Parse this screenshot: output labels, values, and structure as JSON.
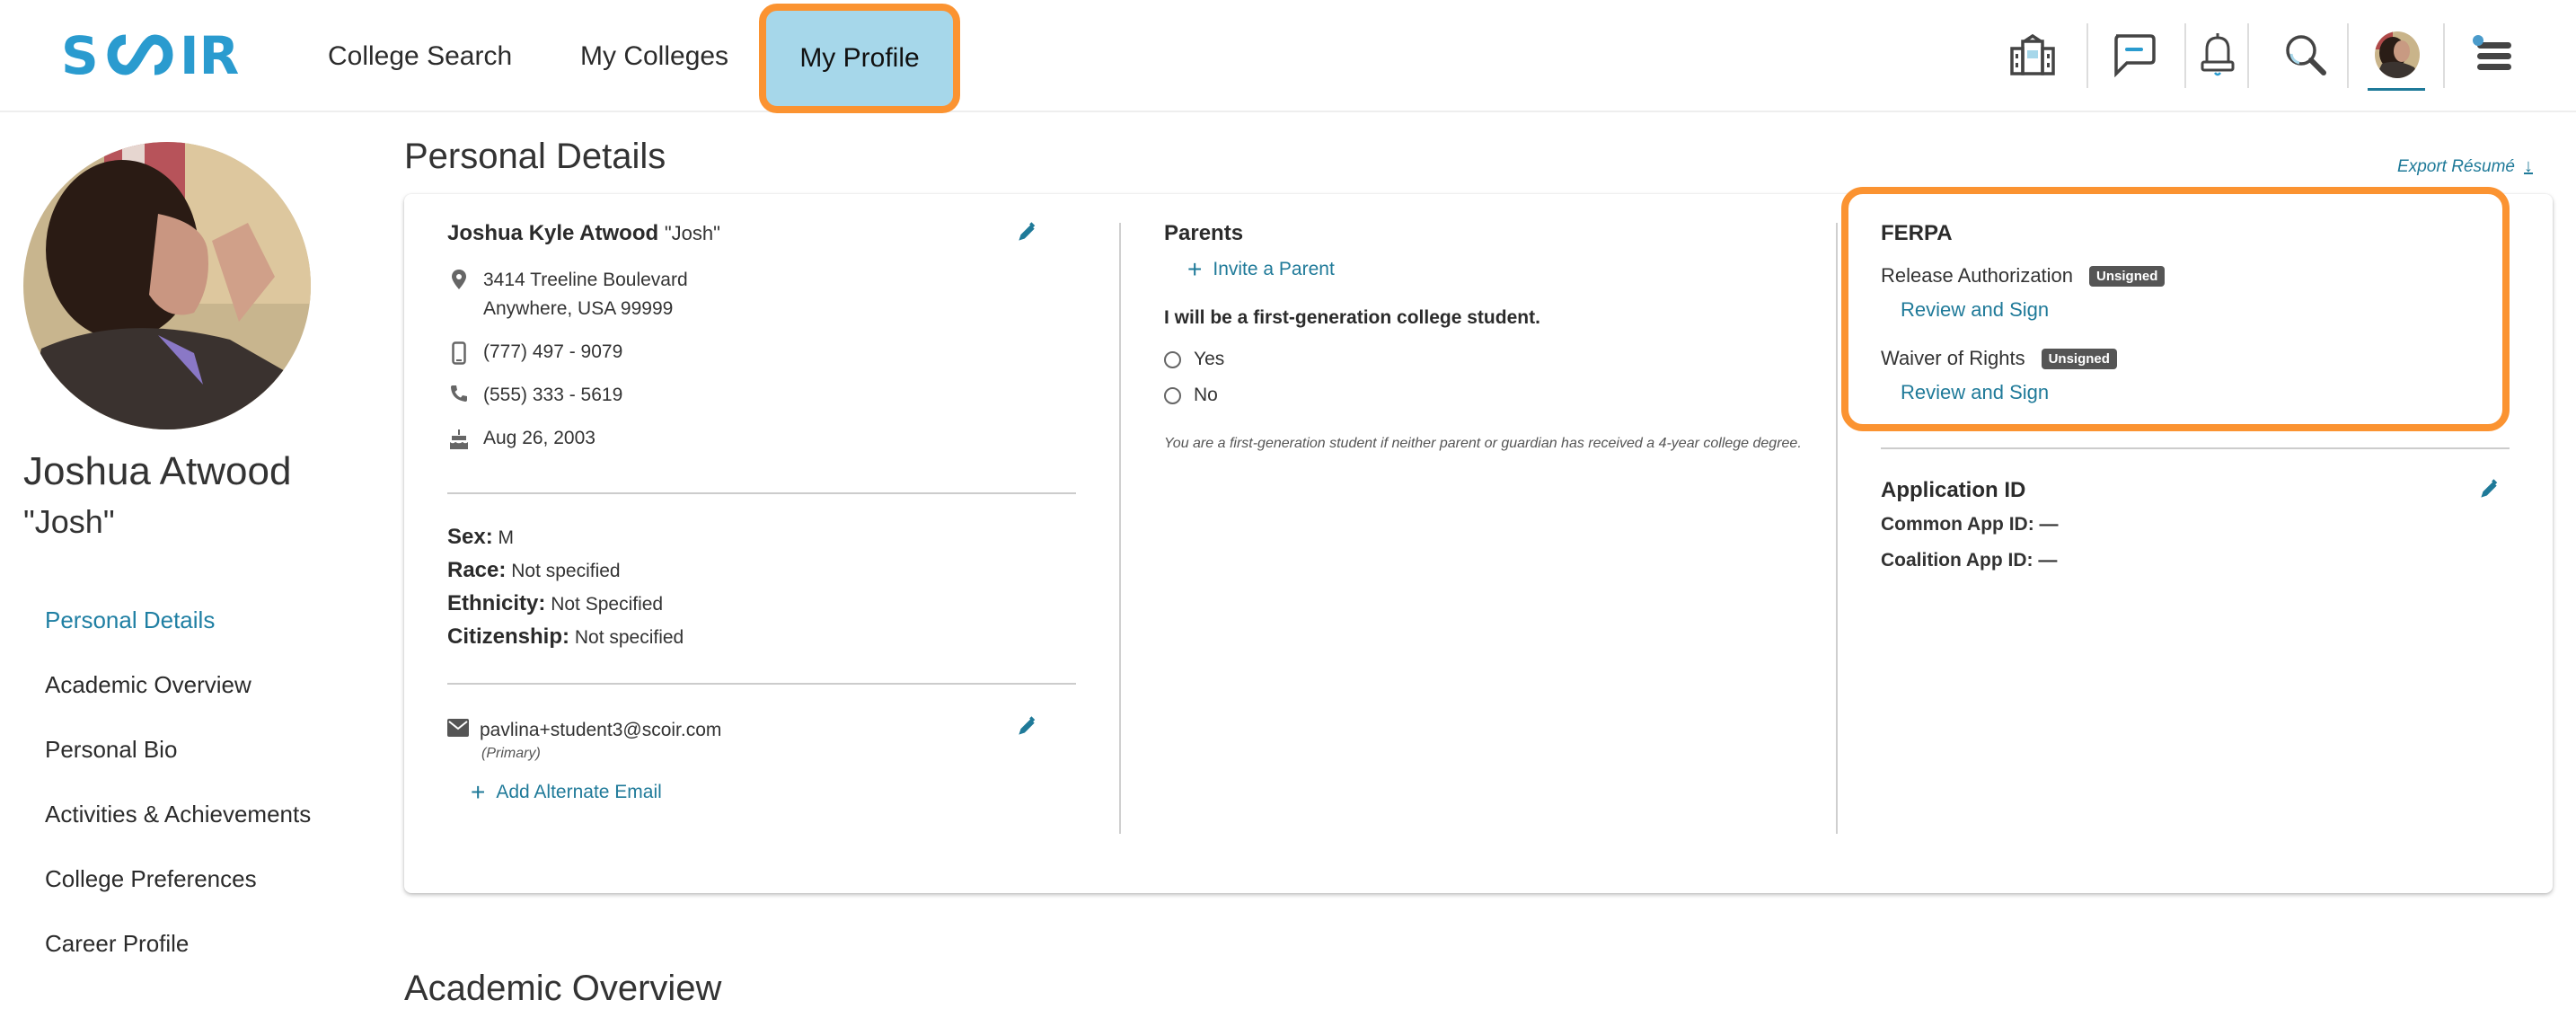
{
  "topnav": {
    "logo_text": "SCOIR",
    "items": [
      {
        "label": "College Search",
        "active": false
      },
      {
        "label": "My Colleges",
        "active": false
      },
      {
        "label": "My Profile",
        "active": true
      }
    ],
    "icons": [
      "college-building-icon",
      "message-icon",
      "bell-icon",
      "search-icon",
      "user-avatar",
      "menu-icon"
    ]
  },
  "colors": {
    "brand": "#2a9bcf",
    "accent_link": "#1f7a99",
    "highlight_fill": "#a6d7ea",
    "highlight_border": "#fb9331",
    "badge_bg": "#555555"
  },
  "profile": {
    "name": "Joshua Atwood",
    "nickname": "\"Josh\""
  },
  "sidenav": {
    "items": [
      {
        "label": "Personal Details",
        "active": true
      },
      {
        "label": "Academic Overview",
        "active": false
      },
      {
        "label": "Personal Bio",
        "active": false
      },
      {
        "label": "Activities & Achievements",
        "active": false
      },
      {
        "label": "College Preferences",
        "active": false
      },
      {
        "label": "Career Profile",
        "active": false
      }
    ]
  },
  "main": {
    "title": "Personal Details",
    "export_label": "Export Résumé",
    "next_section_title": "Academic Overview",
    "contact": {
      "full_name": "Joshua Kyle Atwood",
      "nickname": "\"Josh\"",
      "address_line1": "3414 Treeline Boulevard",
      "address_line2": "Anywhere, USA 99999",
      "mobile": "(777) 497 - 9079",
      "phone": "(555) 333 - 5619",
      "birthday": "Aug 26, 2003"
    },
    "demographics": [
      {
        "label": "Sex:",
        "value": "M"
      },
      {
        "label": "Race:",
        "value": "Not specified"
      },
      {
        "label": "Ethnicity:",
        "value": "Not Specified"
      },
      {
        "label": "Citizenship:",
        "value": "Not specified"
      }
    ],
    "email": {
      "address": "pavlina+student3@scoir.com",
      "note": "(Primary)",
      "add_label": "Add Alternate Email"
    },
    "parents": {
      "title": "Parents",
      "invite_label": "Invite a Parent",
      "question": "I will be a first-generation college student.",
      "options": [
        "Yes",
        "No"
      ],
      "selected": null,
      "note": "You are a first-generation student if neither parent or guardian has received a 4-year college degree."
    },
    "ferpa": {
      "title": "FERPA",
      "items": [
        {
          "label": "Release Authorization",
          "status": "Unsigned",
          "action": "Review and Sign"
        },
        {
          "label": "Waiver of Rights",
          "status": "Unsigned",
          "action": "Review and Sign"
        }
      ]
    },
    "application_id": {
      "title": "Application ID",
      "rows": [
        {
          "label": "Common App ID:",
          "value": "—"
        },
        {
          "label": "Coalition App ID:",
          "value": "—"
        }
      ]
    }
  }
}
